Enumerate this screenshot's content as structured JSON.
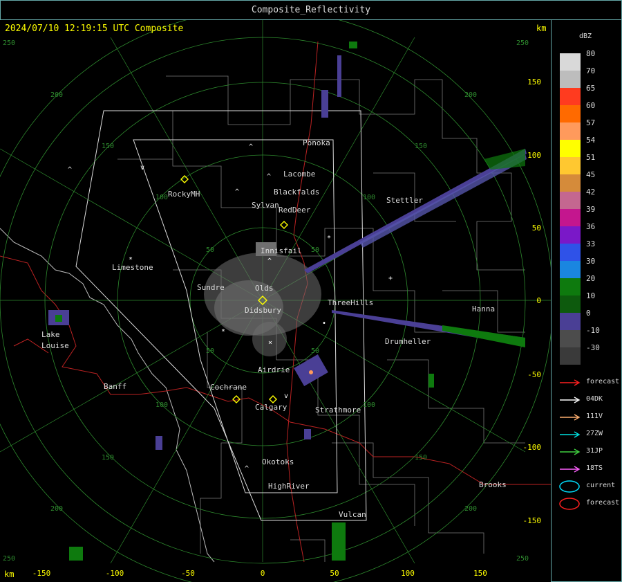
{
  "window": {
    "title": "Composite_Reflectivity"
  },
  "timestamp": "2024/07/10 12:19:15 UTC Composite",
  "units": {
    "top": "km",
    "bottom": "km"
  },
  "axes": {
    "x_ticks": [
      "-150",
      "-100",
      "-50",
      "0",
      "50",
      "100",
      "150"
    ],
    "y_ticks": [
      "150",
      "100",
      "50",
      "0",
      "-50",
      "-100",
      "-150"
    ],
    "corner_labels": [
      "250",
      "250",
      "250",
      "250"
    ]
  },
  "range_rings": [
    "50",
    "100",
    "150",
    "200"
  ],
  "cities": [
    "Ponoka",
    "Lacombe",
    "Blackfalds",
    "RockyMH",
    "Sylvan",
    "RedDeer",
    "Stettler",
    "Innisfail",
    "Limestone",
    "Sundre",
    "Olds",
    "Didsbury",
    "ThreeHills",
    "Hanna",
    "Lake",
    "Louise",
    "Drumheller",
    "Airdrie",
    "Banff",
    "Cochrane",
    "Calgary",
    "Strathmore",
    "Okotoks",
    "HighRiver",
    "Brooks",
    "Vulcan"
  ],
  "legend": {
    "title": "dBZ",
    "scale": [
      {
        "label": "80",
        "color": "#d9d9d9"
      },
      {
        "label": "70",
        "color": "#bdbdbd"
      },
      {
        "label": "65",
        "color": "#ff3b1f"
      },
      {
        "label": "60",
        "color": "#ff6a00"
      },
      {
        "label": "57",
        "color": "#ff9a5c"
      },
      {
        "label": "54",
        "color": "#ffff00"
      },
      {
        "label": "51",
        "color": "#ffc830"
      },
      {
        "label": "45",
        "color": "#d58b3a"
      },
      {
        "label": "42",
        "color": "#c46790"
      },
      {
        "label": "39",
        "color": "#c4168e"
      },
      {
        "label": "36",
        "color": "#7a18c8"
      },
      {
        "label": "33",
        "color": "#2f52e8"
      },
      {
        "label": "30",
        "color": "#1a86e0"
      },
      {
        "label": "20",
        "color": "#0e7a0e"
      },
      {
        "label": "10",
        "color": "#0d5a0d"
      },
      {
        "label": "0",
        "color": "#4a3f95"
      },
      {
        "label": "-10",
        "color": "#4c4c4c"
      },
      {
        "label": "-30",
        "color": "#3a3a3a"
      }
    ],
    "overlays": [
      {
        "label": "forecast",
        "color": "#ff2020",
        "kind": "arrow"
      },
      {
        "label": "04DK",
        "color": "#ffffff",
        "kind": "arrow"
      },
      {
        "label": "111V",
        "color": "#ffb070",
        "kind": "arrow"
      },
      {
        "label": "27ZW",
        "color": "#00e0e0",
        "kind": "arrow"
      },
      {
        "label": "31JP",
        "color": "#40d040",
        "kind": "arrow"
      },
      {
        "label": "18TS",
        "color": "#ff60ff",
        "kind": "arrow"
      },
      {
        "label": "current",
        "color": "#00e0ff",
        "kind": "ellipse"
      },
      {
        "label": "forecast",
        "color": "#ff2020",
        "kind": "ellipse"
      }
    ]
  }
}
